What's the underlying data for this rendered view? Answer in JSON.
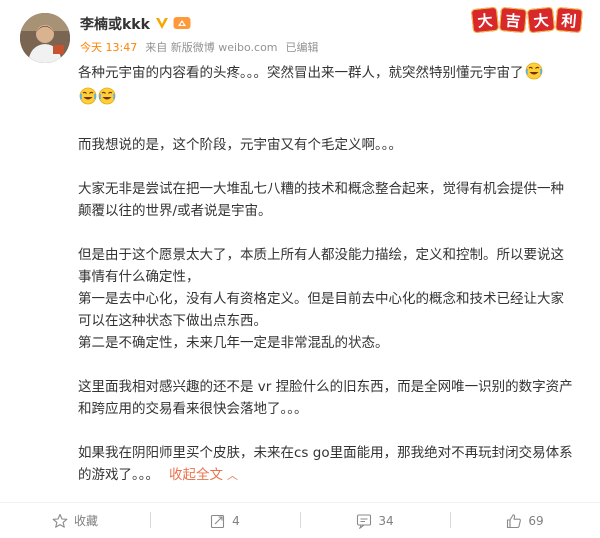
{
  "post": {
    "user_name": "李楠或kkk",
    "time": "今天 13:47",
    "source": "来自 新版微博 weibo.com",
    "edited": "已编辑",
    "stamp": [
      "大",
      "吉",
      "大",
      "利"
    ],
    "paragraphs": [
      "各种元宇宙的内容看的头疼。。。突然冒出来一群人，就突然特别懂元宇宙了",
      "而我想说的是，这个阶段，元宇宙又有个毛定义啊。。。",
      "大家无非是尝试在把一大堆乱七八糟的技术和概念整合起来，觉得有机会提供一种颠覆以往的世界/或者说是宇宙。",
      "但是由于这个愿景太大了，本质上所有人都没能力描绘，定义和控制。所以要说这事情有什么确定性，",
      "第一是去中心化，没有人有资格定义。但是目前去中心化的概念和技术已经让大家可以在这种状态下做出点东西。",
      "第二是不确定性，未来几年一定是非常混乱的状态。",
      "这里面我相对感兴趣的还不是 vr 捏脸什么的旧东西，而是全网唯一识别的数字资产和跨应用的交易看来很快会落地了。。。",
      "如果我在阴阳师里买个皮肤，未来在cs go里面能用，那我绝对不再玩封闭交易体系的游戏了。。。"
    ],
    "collapse_label": "收起全文",
    "emoji_name": "laugh-cry-emoji"
  },
  "actions": {
    "favorite_label": "收藏",
    "repost_count": "4",
    "comment_count": "34",
    "like_count": "69"
  },
  "colors": {
    "time": "#ff8200",
    "link": "#eb7350",
    "muted": "#939393",
    "vip_badge": "#f7a700",
    "stamp_red": "#d8282c"
  }
}
